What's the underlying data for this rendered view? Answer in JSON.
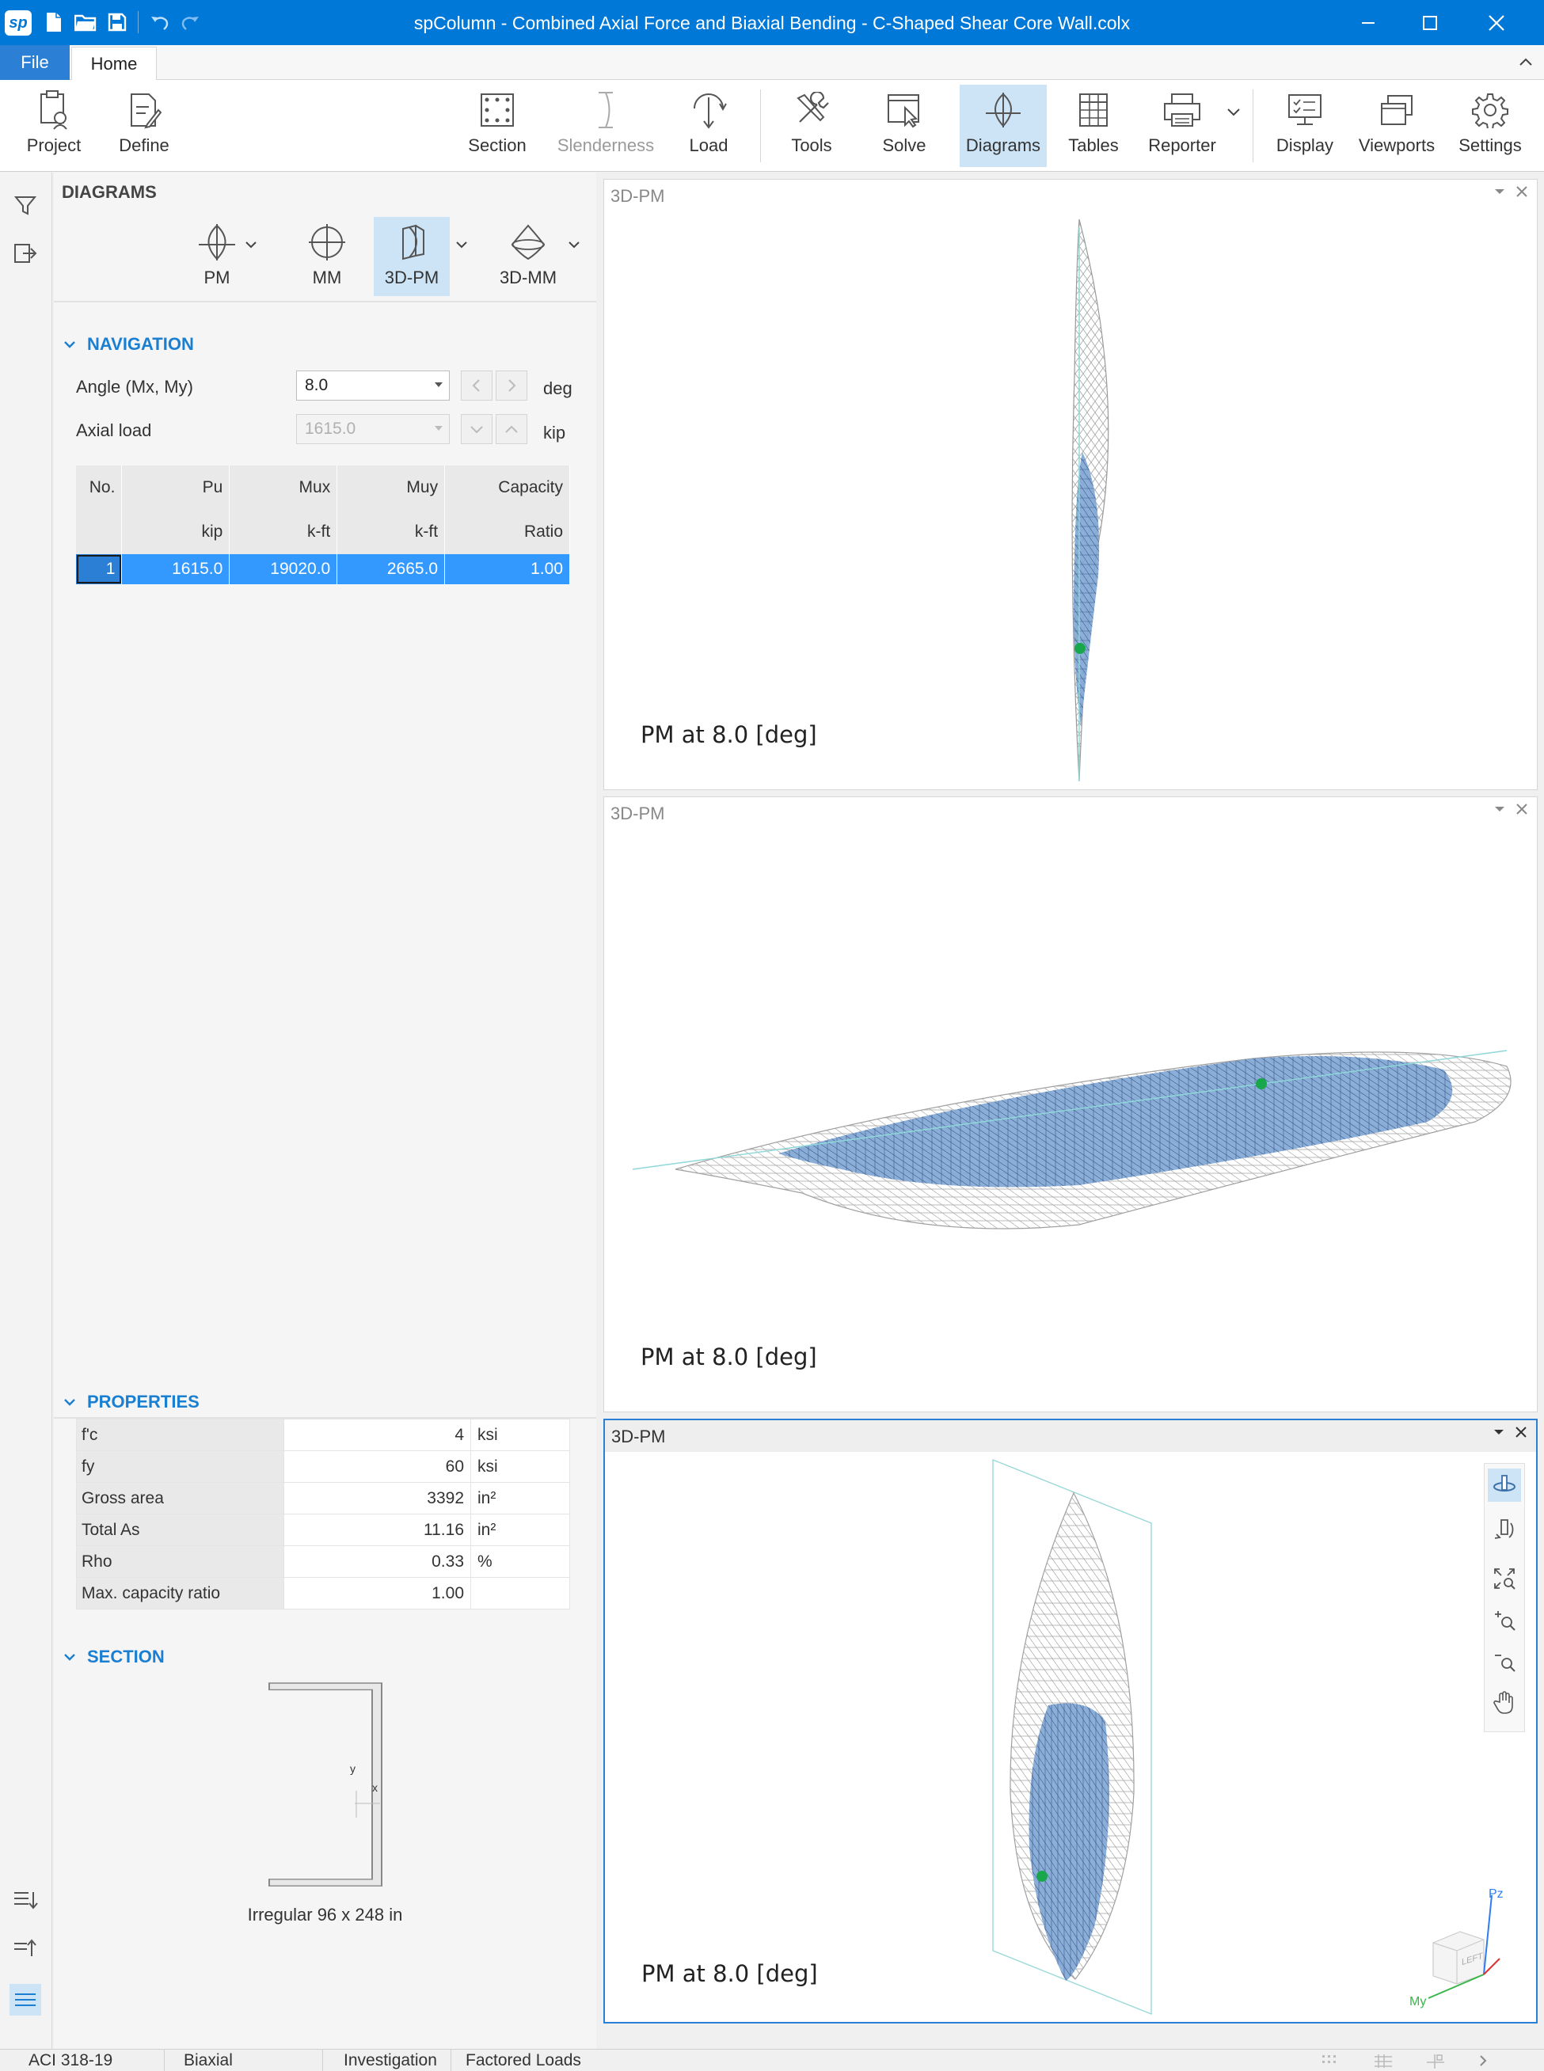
{
  "window": {
    "app_logo": "sp",
    "title": "spColumn - Combined Axial Force and Biaxial Bending - C-Shaped Shear Core Wall.colx"
  },
  "tabs": {
    "file": "File",
    "home": "Home"
  },
  "ribbon": {
    "project": "Project",
    "define": "Define",
    "section": "Section",
    "slenderness": "Slenderness",
    "load": "Load",
    "tools": "Tools",
    "solve": "Solve",
    "diagrams": "Diagrams",
    "tables": "Tables",
    "reporter": "Reporter",
    "display": "Display",
    "viewports": "Viewports",
    "settings": "Settings"
  },
  "left_panel": {
    "header": "DIAGRAMS",
    "diagram_buttons": {
      "pm": "PM",
      "mm": "MM",
      "pm3d": "3D-PM",
      "mm3d": "3D-MM"
    },
    "navigation": {
      "title": "NAVIGATION",
      "angle_label": "Angle (Mx, My)",
      "angle_value": "8.0",
      "angle_unit": "deg",
      "axial_label": "Axial load",
      "axial_value": "1615.0",
      "axial_unit": "kip",
      "table": {
        "headers": [
          "No.",
          "Pu",
          "Mux",
          "Muy",
          "Capacity"
        ],
        "units": [
          "",
          "kip",
          "k-ft",
          "k-ft",
          "Ratio"
        ],
        "rows": [
          [
            "1",
            "1615.0",
            "19020.0",
            "2665.0",
            "1.00"
          ]
        ]
      }
    },
    "properties": {
      "title": "PROPERTIES",
      "rows": [
        {
          "name": "f'c",
          "value": "4",
          "unit": "ksi"
        },
        {
          "name": "fy",
          "value": "60",
          "unit": "ksi"
        },
        {
          "name": "Gross area",
          "value": "3392",
          "unit": "in²"
        },
        {
          "name": "Total As",
          "value": "11.16",
          "unit": "in²"
        },
        {
          "name": "Rho",
          "value": "0.33",
          "unit": "%"
        },
        {
          "name": "Max. capacity ratio",
          "value": "1.00",
          "unit": ""
        }
      ]
    },
    "section": {
      "title": "SECTION",
      "axis_y": "y",
      "axis_x": "x",
      "caption": "Irregular 96 x 248 in"
    }
  },
  "viewports": [
    {
      "title": "3D-PM",
      "caption": "PM at 8.0 [deg]"
    },
    {
      "title": "3D-PM",
      "caption": "PM at 8.0 [deg]"
    },
    {
      "title": "3D-PM",
      "caption": "PM at 8.0 [deg]",
      "cube_label_pz": "Pz",
      "cube_label_my": "My",
      "cube_face": "LEFT"
    }
  ],
  "status_bar": {
    "code": "ACI 318-19",
    "mode": "Biaxial",
    "run": "Investigation",
    "loads": "Factored Loads"
  },
  "colors": {
    "title_bar": "#0078d7",
    "accent": "#1a7fd1",
    "selection": "#3399ff",
    "surface_fill": "#7fa6d6",
    "mesh_gray": "#b8b8b8",
    "point_green": "#18a84b"
  }
}
